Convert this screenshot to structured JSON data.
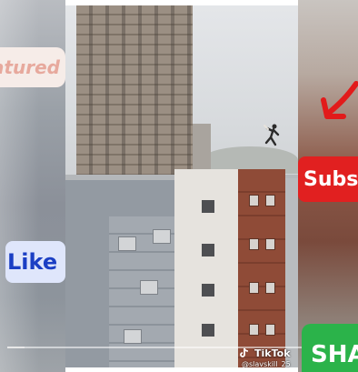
{
  "overlays": {
    "featured_label": "atured",
    "like_label": "Like",
    "subscribe_label": "Subscr",
    "share_label": "SHA"
  },
  "watermark": {
    "app_name": "TikTok",
    "handle": "@slavskill_25"
  },
  "progress": {
    "played_fraction": 0.05
  },
  "colors": {
    "subscribe_red": "#e12020",
    "like_blue": "#1b3fc4",
    "share_green": "#2bb34a",
    "arrow_red": "#e21b1b"
  },
  "icons": [
    "tiktok-icon",
    "arrow-icon"
  ]
}
